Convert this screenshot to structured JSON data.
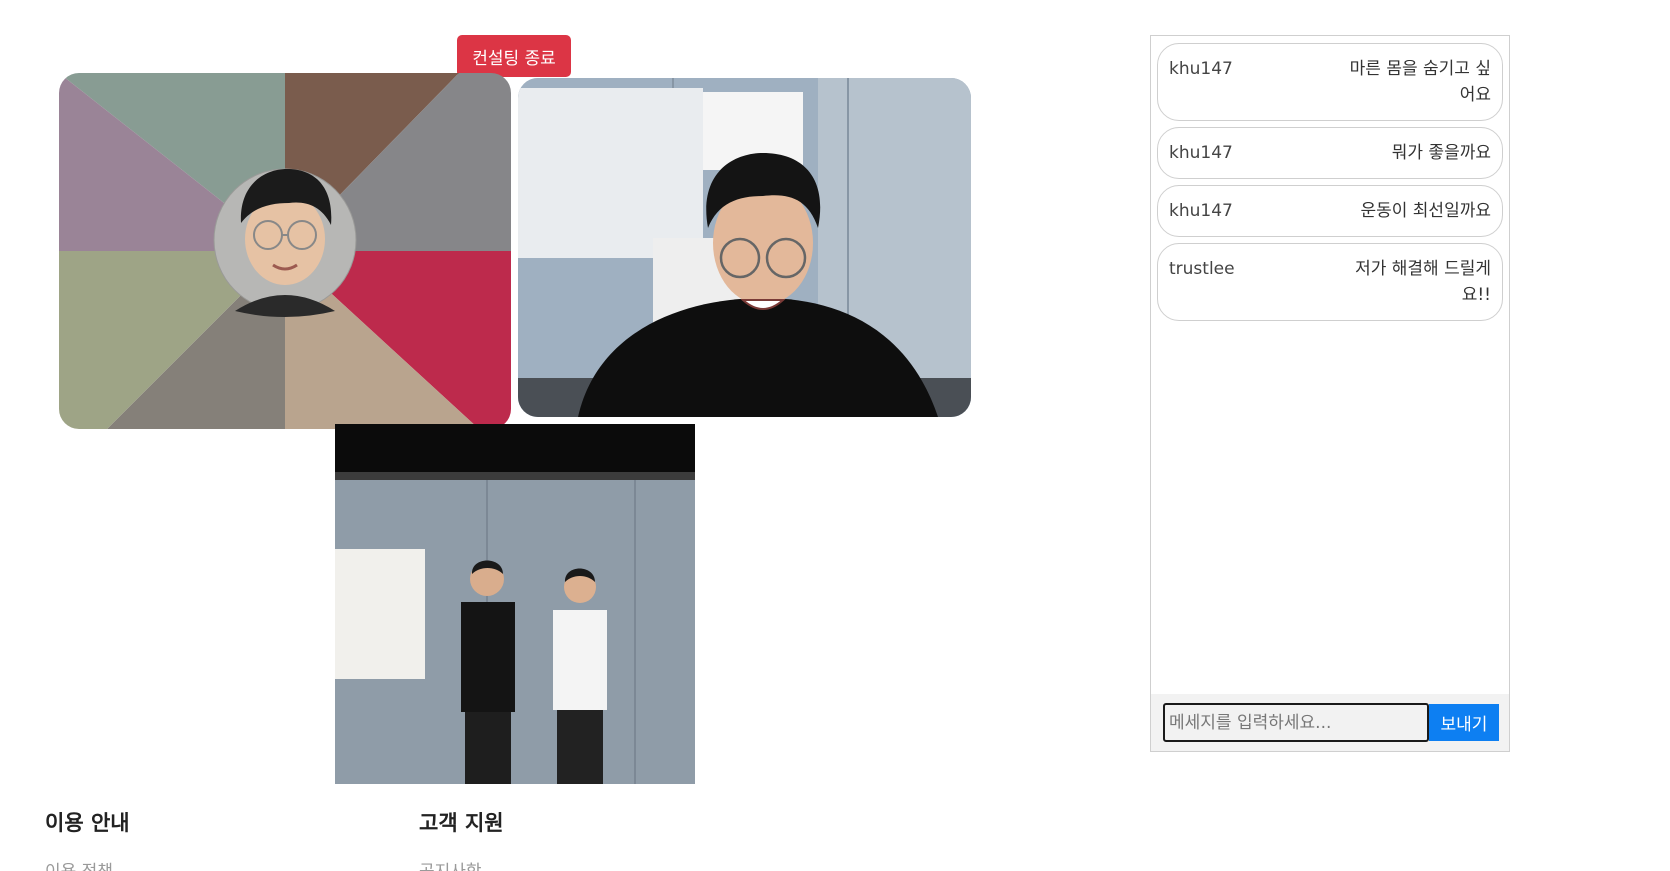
{
  "controls": {
    "end_consulting_label": "컨설팅 종료"
  },
  "chat": {
    "messages": [
      {
        "user": "khu147",
        "text": "마른 몸을 숨기고 싶어요"
      },
      {
        "user": "khu147",
        "text": "뭐가 좋을까요"
      },
      {
        "user": "khu147",
        "text": "운동이 최선일까요"
      },
      {
        "user": "trustlee",
        "text": "저가 해결해 드릴게요!!"
      }
    ],
    "input_placeholder": "메세지를 입력하세요...",
    "input_value": "",
    "send_label": "보내기"
  },
  "footer": {
    "columns": [
      {
        "heading": "이용 안내",
        "link": "이용 정책"
      },
      {
        "heading": "고객 지원",
        "link": "공지사항"
      }
    ]
  },
  "colors": {
    "end_button": "#dc3545",
    "send_button": "#0d7ff2",
    "avatar_segments": [
      "#9a8497",
      "#889c93",
      "#7a5c4d",
      "#868689",
      "#bd2a4c",
      "#b9a48e",
      "#858079",
      "#9ea486"
    ]
  }
}
